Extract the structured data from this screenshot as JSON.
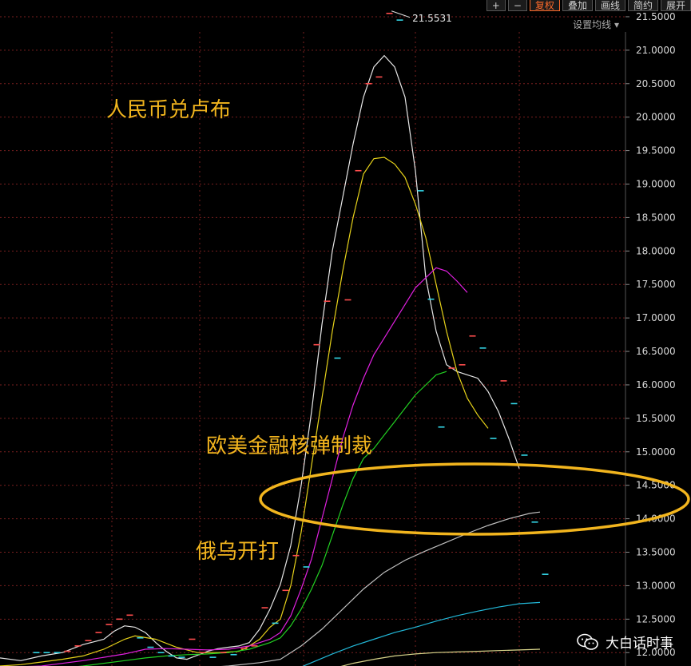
{
  "toolbar": {
    "plus": "+",
    "minus": "−",
    "adjust": "复权",
    "overlay": "叠加",
    "draw": "画线",
    "simple": "简约",
    "expand": "展开"
  },
  "ma_setting_label": "设置均线",
  "annotations": {
    "title": "人民币兑卢布",
    "sanction": "欧美金融核弹制裁",
    "war": "俄乌开打"
  },
  "watermark": "大白话时事",
  "colors": {
    "up": "#ff4d4d",
    "down": "#33d6e6",
    "ma_white": "#e6e6e6",
    "ma_yellow": "#e6d21a",
    "ma_magenta": "#e020e0",
    "ma_green": "#22d022",
    "ma_gray": "#bfbfbf",
    "ma_cyan": "#22b8d8",
    "ma_khaki": "#d8d48a",
    "ellipse": "#f2b51e",
    "grid": "#7a1f1f"
  },
  "chart_data": {
    "type": "line",
    "ylim": [
      11.8,
      21.75
    ],
    "x_range": [
      0,
      60
    ],
    "yticks": [
      "12.0000",
      "12.5000",
      "13.0000",
      "13.5000",
      "14.0000",
      "14.5000",
      "15.0000",
      "15.5000",
      "16.0000",
      "16.5000",
      "17.0000",
      "17.5000",
      "18.0000",
      "18.5000",
      "19.0000",
      "19.5000",
      "20.0000",
      "20.5000",
      "21.0000",
      "21.5000"
    ],
    "peak_label": "21.5531",
    "peak_point": {
      "x": 39.7,
      "y": 21.55
    },
    "marks": [
      {
        "x": 0.5,
        "y": 11.72,
        "t": "down"
      },
      {
        "x": 1.5,
        "y": 11.74,
        "t": "down"
      },
      {
        "x": 2.5,
        "y": 11.66,
        "t": "up"
      },
      {
        "x": 3.5,
        "y": 12.0,
        "t": "down"
      },
      {
        "x": 4.5,
        "y": 12.0,
        "t": "down"
      },
      {
        "x": 5.5,
        "y": 12.0,
        "t": "down"
      },
      {
        "x": 6.5,
        "y": 12.02,
        "t": "up"
      },
      {
        "x": 7.5,
        "y": 12.1,
        "t": "up"
      },
      {
        "x": 8.5,
        "y": 12.18,
        "t": "up"
      },
      {
        "x": 9.5,
        "y": 12.3,
        "t": "up"
      },
      {
        "x": 10.5,
        "y": 12.42,
        "t": "up"
      },
      {
        "x": 11.5,
        "y": 12.5,
        "t": "up"
      },
      {
        "x": 12.5,
        "y": 12.56,
        "t": "up"
      },
      {
        "x": 13.5,
        "y": 12.22,
        "t": "down"
      },
      {
        "x": 14.5,
        "y": 12.08,
        "t": "down"
      },
      {
        "x": 15.5,
        "y": 12.0,
        "t": "down"
      },
      {
        "x": 16.5,
        "y": 11.95,
        "t": "down"
      },
      {
        "x": 17.5,
        "y": 11.93,
        "t": "down"
      },
      {
        "x": 18.5,
        "y": 12.2,
        "t": "up"
      },
      {
        "x": 19.5,
        "y": 12.0,
        "t": "up"
      },
      {
        "x": 20.5,
        "y": 11.93,
        "t": "down"
      },
      {
        "x": 21.5,
        "y": 12.0,
        "t": "up"
      },
      {
        "x": 22.5,
        "y": 11.97,
        "t": "down"
      },
      {
        "x": 23.5,
        "y": 12.06,
        "t": "up"
      },
      {
        "x": 24.5,
        "y": 12.1,
        "t": "up"
      },
      {
        "x": 25.5,
        "y": 12.67,
        "t": "up"
      },
      {
        "x": 26.5,
        "y": 12.44,
        "t": "down"
      },
      {
        "x": 27.5,
        "y": 12.93,
        "t": "up"
      },
      {
        "x": 28.5,
        "y": 13.45,
        "t": "up"
      },
      {
        "x": 29.5,
        "y": 13.28,
        "t": "down"
      },
      {
        "x": 30.5,
        "y": 16.6,
        "t": "up"
      },
      {
        "x": 31.5,
        "y": 17.25,
        "t": "up"
      },
      {
        "x": 32.5,
        "y": 16.4,
        "t": "down"
      },
      {
        "x": 33.5,
        "y": 17.27,
        "t": "up"
      },
      {
        "x": 34.5,
        "y": 19.2,
        "t": "up"
      },
      {
        "x": 35.5,
        "y": 20.5,
        "t": "up"
      },
      {
        "x": 36.5,
        "y": 20.6,
        "t": "up"
      },
      {
        "x": 37.5,
        "y": 21.55,
        "t": "up"
      },
      {
        "x": 38.5,
        "y": 21.45,
        "t": "down"
      },
      {
        "x": 40.5,
        "y": 18.9,
        "t": "down"
      },
      {
        "x": 41.5,
        "y": 17.28,
        "t": "down"
      },
      {
        "x": 42.5,
        "y": 15.37,
        "t": "down"
      },
      {
        "x": 43.5,
        "y": 16.25,
        "t": "up"
      },
      {
        "x": 44.5,
        "y": 16.3,
        "t": "up"
      },
      {
        "x": 45.5,
        "y": 16.73,
        "t": "up"
      },
      {
        "x": 46.5,
        "y": 16.55,
        "t": "down"
      },
      {
        "x": 47.5,
        "y": 15.2,
        "t": "down"
      },
      {
        "x": 48.5,
        "y": 16.06,
        "t": "up"
      },
      {
        "x": 49.5,
        "y": 15.72,
        "t": "down"
      },
      {
        "x": 50.5,
        "y": 14.95,
        "t": "down"
      },
      {
        "x": 51.5,
        "y": 13.95,
        "t": "down"
      },
      {
        "x": 52.5,
        "y": 13.17,
        "t": "down"
      }
    ],
    "series": [
      {
        "color": "#e6e6e6",
        "values": [
          [
            0,
            11.92
          ],
          [
            2,
            11.88
          ],
          [
            4,
            11.95
          ],
          [
            6,
            12.0
          ],
          [
            8,
            12.12
          ],
          [
            10,
            12.2
          ],
          [
            11,
            12.32
          ],
          [
            12,
            12.4
          ],
          [
            13,
            12.38
          ],
          [
            14,
            12.3
          ],
          [
            15,
            12.15
          ],
          [
            16,
            12.02
          ],
          [
            17,
            11.92
          ],
          [
            18,
            11.9
          ],
          [
            19,
            11.96
          ],
          [
            20,
            12.02
          ],
          [
            21,
            12.06
          ],
          [
            22,
            12.08
          ],
          [
            23,
            12.1
          ],
          [
            24,
            12.15
          ],
          [
            25,
            12.35
          ],
          [
            26,
            12.65
          ],
          [
            27,
            13.02
          ],
          [
            28,
            13.6
          ],
          [
            29,
            14.5
          ],
          [
            30,
            15.6
          ],
          [
            31,
            16.9
          ],
          [
            32,
            18.0
          ],
          [
            33,
            18.8
          ],
          [
            34,
            19.6
          ],
          [
            35,
            20.3
          ],
          [
            36,
            20.75
          ],
          [
            37,
            20.92
          ],
          [
            38,
            20.75
          ],
          [
            39,
            20.3
          ],
          [
            40,
            19.2
          ],
          [
            41,
            17.6
          ],
          [
            42,
            16.8
          ],
          [
            43,
            16.3
          ],
          [
            44,
            16.2
          ],
          [
            45,
            16.15
          ],
          [
            46,
            16.1
          ],
          [
            47,
            15.9
          ],
          [
            48,
            15.6
          ],
          [
            49,
            15.2
          ],
          [
            50,
            14.75
          ]
        ]
      },
      {
        "color": "#e6d21a",
        "values": [
          [
            0,
            11.8
          ],
          [
            2,
            11.82
          ],
          [
            4,
            11.86
          ],
          [
            6,
            11.9
          ],
          [
            8,
            11.95
          ],
          [
            10,
            12.05
          ],
          [
            12,
            12.2
          ],
          [
            13,
            12.25
          ],
          [
            15,
            12.2
          ],
          [
            17,
            12.08
          ],
          [
            19,
            12.0
          ],
          [
            21,
            12.0
          ],
          [
            23,
            12.02
          ],
          [
            24,
            12.1
          ],
          [
            25,
            12.2
          ],
          [
            26,
            12.38
          ],
          [
            27,
            12.5
          ],
          [
            28,
            13.0
          ],
          [
            29,
            13.8
          ],
          [
            30,
            14.8
          ],
          [
            31,
            15.8
          ],
          [
            32,
            16.8
          ],
          [
            33,
            17.7
          ],
          [
            34,
            18.5
          ],
          [
            35,
            19.15
          ],
          [
            36,
            19.38
          ],
          [
            37,
            19.4
          ],
          [
            38,
            19.3
          ],
          [
            39,
            19.1
          ],
          [
            40,
            18.7
          ],
          [
            41,
            18.2
          ],
          [
            42,
            17.5
          ],
          [
            43,
            16.8
          ],
          [
            44,
            16.2
          ],
          [
            45,
            15.8
          ],
          [
            46,
            15.55
          ],
          [
            47,
            15.35
          ]
        ]
      },
      {
        "color": "#e020e0",
        "values": [
          [
            0,
            11.78
          ],
          [
            4,
            11.8
          ],
          [
            8,
            11.88
          ],
          [
            12,
            11.98
          ],
          [
            14,
            12.05
          ],
          [
            16,
            12.06
          ],
          [
            18,
            12.05
          ],
          [
            20,
            12.04
          ],
          [
            22,
            12.05
          ],
          [
            24,
            12.1
          ],
          [
            26,
            12.2
          ],
          [
            27,
            12.3
          ],
          [
            28,
            12.55
          ],
          [
            29,
            12.95
          ],
          [
            30,
            13.4
          ],
          [
            31,
            14.0
          ],
          [
            32,
            14.6
          ],
          [
            33,
            15.2
          ],
          [
            34,
            15.7
          ],
          [
            35,
            16.1
          ],
          [
            36,
            16.45
          ],
          [
            37,
            16.7
          ],
          [
            38,
            16.95
          ],
          [
            39,
            17.2
          ],
          [
            40,
            17.45
          ],
          [
            41,
            17.6
          ],
          [
            42,
            17.75
          ],
          [
            43,
            17.7
          ],
          [
            44,
            17.55
          ],
          [
            45,
            17.38
          ]
        ]
      },
      {
        "color": "#22d022",
        "values": [
          [
            0,
            11.7
          ],
          [
            4,
            11.74
          ],
          [
            8,
            11.8
          ],
          [
            12,
            11.88
          ],
          [
            14,
            11.92
          ],
          [
            16,
            11.95
          ],
          [
            18,
            11.97
          ],
          [
            20,
            11.98
          ],
          [
            22,
            12.0
          ],
          [
            24,
            12.05
          ],
          [
            26,
            12.15
          ],
          [
            27,
            12.22
          ],
          [
            28,
            12.4
          ],
          [
            29,
            12.65
          ],
          [
            30,
            12.95
          ],
          [
            31,
            13.3
          ],
          [
            32,
            13.75
          ],
          [
            33,
            14.2
          ],
          [
            34,
            14.6
          ],
          [
            35,
            14.9
          ],
          [
            36,
            15.05
          ],
          [
            37,
            15.25
          ],
          [
            38,
            15.45
          ],
          [
            39,
            15.65
          ],
          [
            40,
            15.85
          ],
          [
            41,
            16.0
          ],
          [
            42,
            16.15
          ],
          [
            43,
            16.2
          ]
        ]
      },
      {
        "color": "#bfbfbf",
        "values": [
          [
            0,
            11.55
          ],
          [
            6,
            11.58
          ],
          [
            10,
            11.65
          ],
          [
            14,
            11.72
          ],
          [
            18,
            11.76
          ],
          [
            22,
            11.8
          ],
          [
            25,
            11.85
          ],
          [
            27,
            11.9
          ],
          [
            29,
            12.1
          ],
          [
            31,
            12.35
          ],
          [
            33,
            12.65
          ],
          [
            35,
            12.95
          ],
          [
            37,
            13.2
          ],
          [
            39,
            13.38
          ],
          [
            41,
            13.52
          ],
          [
            43,
            13.65
          ],
          [
            45,
            13.78
          ],
          [
            47,
            13.9
          ],
          [
            49,
            14.0
          ],
          [
            51,
            14.08
          ],
          [
            52,
            14.1
          ]
        ]
      },
      {
        "color": "#22b8d8",
        "values": [
          [
            0,
            11.48
          ],
          [
            8,
            11.5
          ],
          [
            14,
            11.53
          ],
          [
            20,
            11.56
          ],
          [
            24,
            11.6
          ],
          [
            26,
            11.65
          ],
          [
            28,
            11.72
          ],
          [
            30,
            11.85
          ],
          [
            32,
            11.98
          ],
          [
            34,
            12.1
          ],
          [
            36,
            12.2
          ],
          [
            38,
            12.3
          ],
          [
            40,
            12.38
          ],
          [
            42,
            12.47
          ],
          [
            44,
            12.55
          ],
          [
            46,
            12.62
          ],
          [
            48,
            12.68
          ],
          [
            50,
            12.73
          ],
          [
            52,
            12.75
          ]
        ]
      },
      {
        "color": "#d8d48a",
        "values": [
          [
            0,
            11.42
          ],
          [
            10,
            11.44
          ],
          [
            18,
            11.48
          ],
          [
            24,
            11.52
          ],
          [
            28,
            11.6
          ],
          [
            30,
            11.68
          ],
          [
            32,
            11.76
          ],
          [
            34,
            11.84
          ],
          [
            36,
            11.9
          ],
          [
            38,
            11.95
          ],
          [
            40,
            11.98
          ],
          [
            42,
            12.0
          ],
          [
            44,
            12.01
          ],
          [
            46,
            12.02
          ],
          [
            48,
            12.03
          ],
          [
            50,
            12.04
          ],
          [
            52,
            12.05
          ]
        ]
      }
    ]
  }
}
